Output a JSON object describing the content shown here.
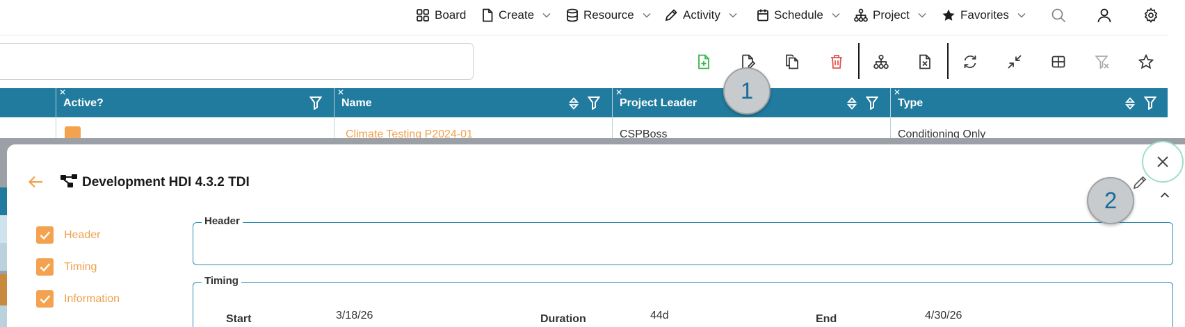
{
  "nav": {
    "items": [
      {
        "label": "Board",
        "icon": "board-icon"
      },
      {
        "label": "Create",
        "icon": "file-icon"
      },
      {
        "label": "Resource",
        "icon": "database-icon"
      },
      {
        "label": "Activity",
        "icon": "pencil-icon"
      },
      {
        "label": "Schedule",
        "icon": "calendar-icon"
      },
      {
        "label": "Project",
        "icon": "hierarchy-icon"
      },
      {
        "label": "Favorites",
        "icon": "star-icon"
      }
    ],
    "icons": [
      "search-icon",
      "user-icon",
      "gear-icon"
    ]
  },
  "toolbar": {
    "icons": [
      "add-file-icon",
      "edit-file-icon",
      "copy-icon",
      "delete-icon",
      "hierarchy-icon",
      "excel-icon",
      "refresh-icon",
      "collapse-icon",
      "grid-icon",
      "clear-filter-icon",
      "star-icon"
    ],
    "colors": {
      "add": "#3bb54a",
      "delete": "#e05252"
    }
  },
  "table": {
    "columns": [
      "Active?",
      "Name",
      "Project Leader",
      "Type"
    ],
    "row": {
      "name": "Climate Testing P2024-01",
      "leader": "CSPBoss",
      "type": "Conditioning Only"
    },
    "header_color": "#207b9e",
    "accent": "#f3a24f"
  },
  "modal": {
    "title": "Development HDI 4.3.2 TDI",
    "nav": [
      "Header",
      "Timing",
      "Information"
    ],
    "sections": {
      "header": "Header",
      "timing": "Timing"
    },
    "timing": {
      "start_label": "Start",
      "start_value": "3/18/26",
      "duration_label": "Duration",
      "duration_value": "44d",
      "end_label": "End",
      "end_value": "4/30/26"
    }
  },
  "annotations": {
    "one": "1",
    "two": "2"
  }
}
